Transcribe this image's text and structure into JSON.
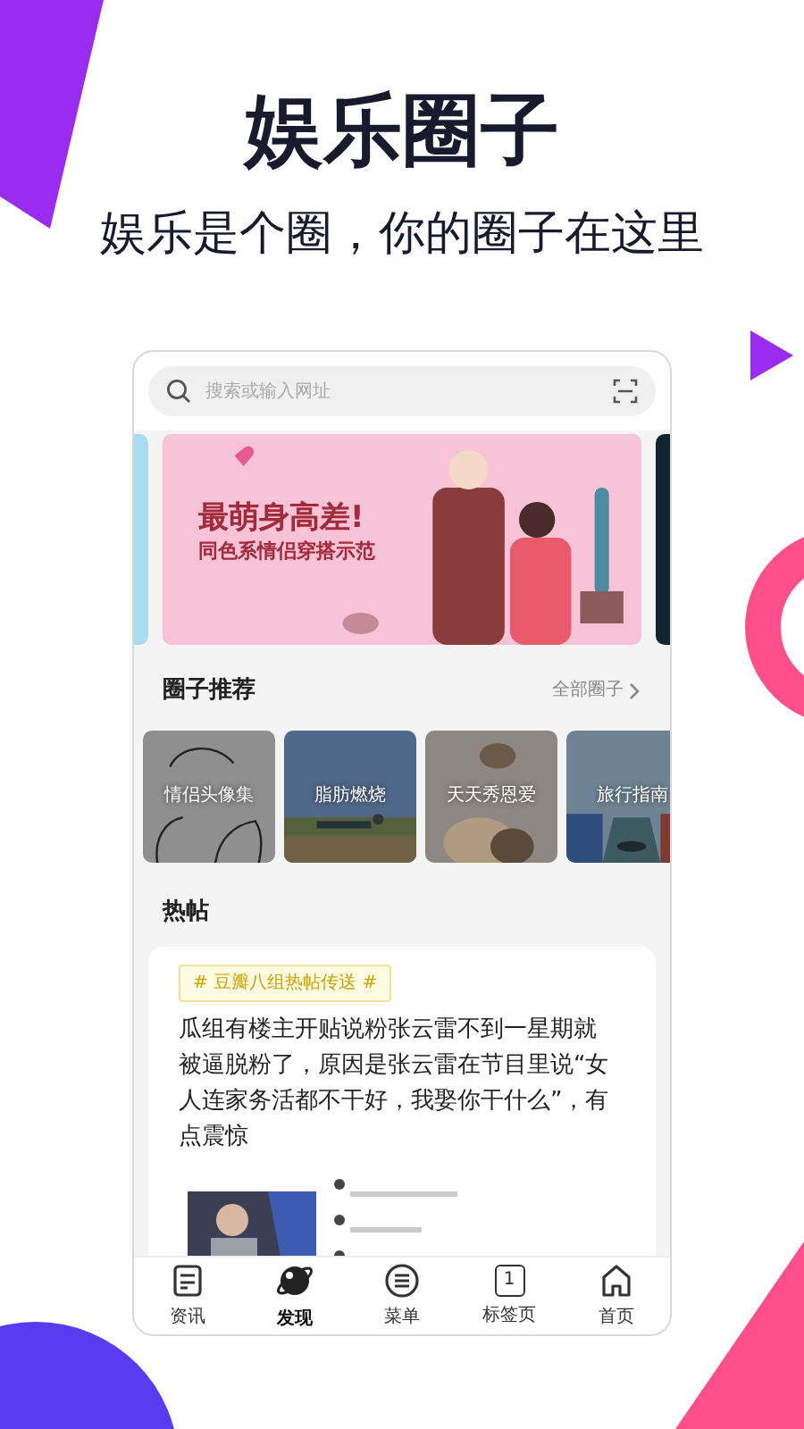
{
  "promo": {
    "title": "娱乐圈子",
    "subtitle": "娱乐是个圈，你的圈子在这里"
  },
  "search": {
    "placeholder": "搜索或输入网址"
  },
  "banner": {
    "headline": "最萌身高差!",
    "subline": "同色系情侣穿搭示范"
  },
  "circles": {
    "title": "圈子推荐",
    "more": "全部圈子",
    "items": [
      {
        "label": "情侣头像集",
        "kind": "sketch"
      },
      {
        "label": "脂肪燃烧",
        "kind": "field"
      },
      {
        "label": "天天秀恩爱",
        "kind": "cat"
      },
      {
        "label": "旅行指南",
        "kind": "canal"
      }
    ]
  },
  "hot": {
    "title": "热帖",
    "post": {
      "tag": "# 豆瓣八组热帖传送 #",
      "text": "瓜组有楼主开贴说粉张云雷不到一星期就被逼脱粉了，原因是张云雷在节目里说“女人连家务活都不干好，我娶你干什么”，有点震惊"
    }
  },
  "nav": [
    {
      "label": "资讯",
      "kind": "news",
      "selected": false
    },
    {
      "label": "发现",
      "kind": "planet",
      "selected": true
    },
    {
      "label": "菜单",
      "kind": "menu",
      "selected": false
    },
    {
      "label": "标签页",
      "kind": "tabs",
      "badge": "1",
      "selected": false
    },
    {
      "label": "首页",
      "kind": "home",
      "selected": false
    }
  ]
}
